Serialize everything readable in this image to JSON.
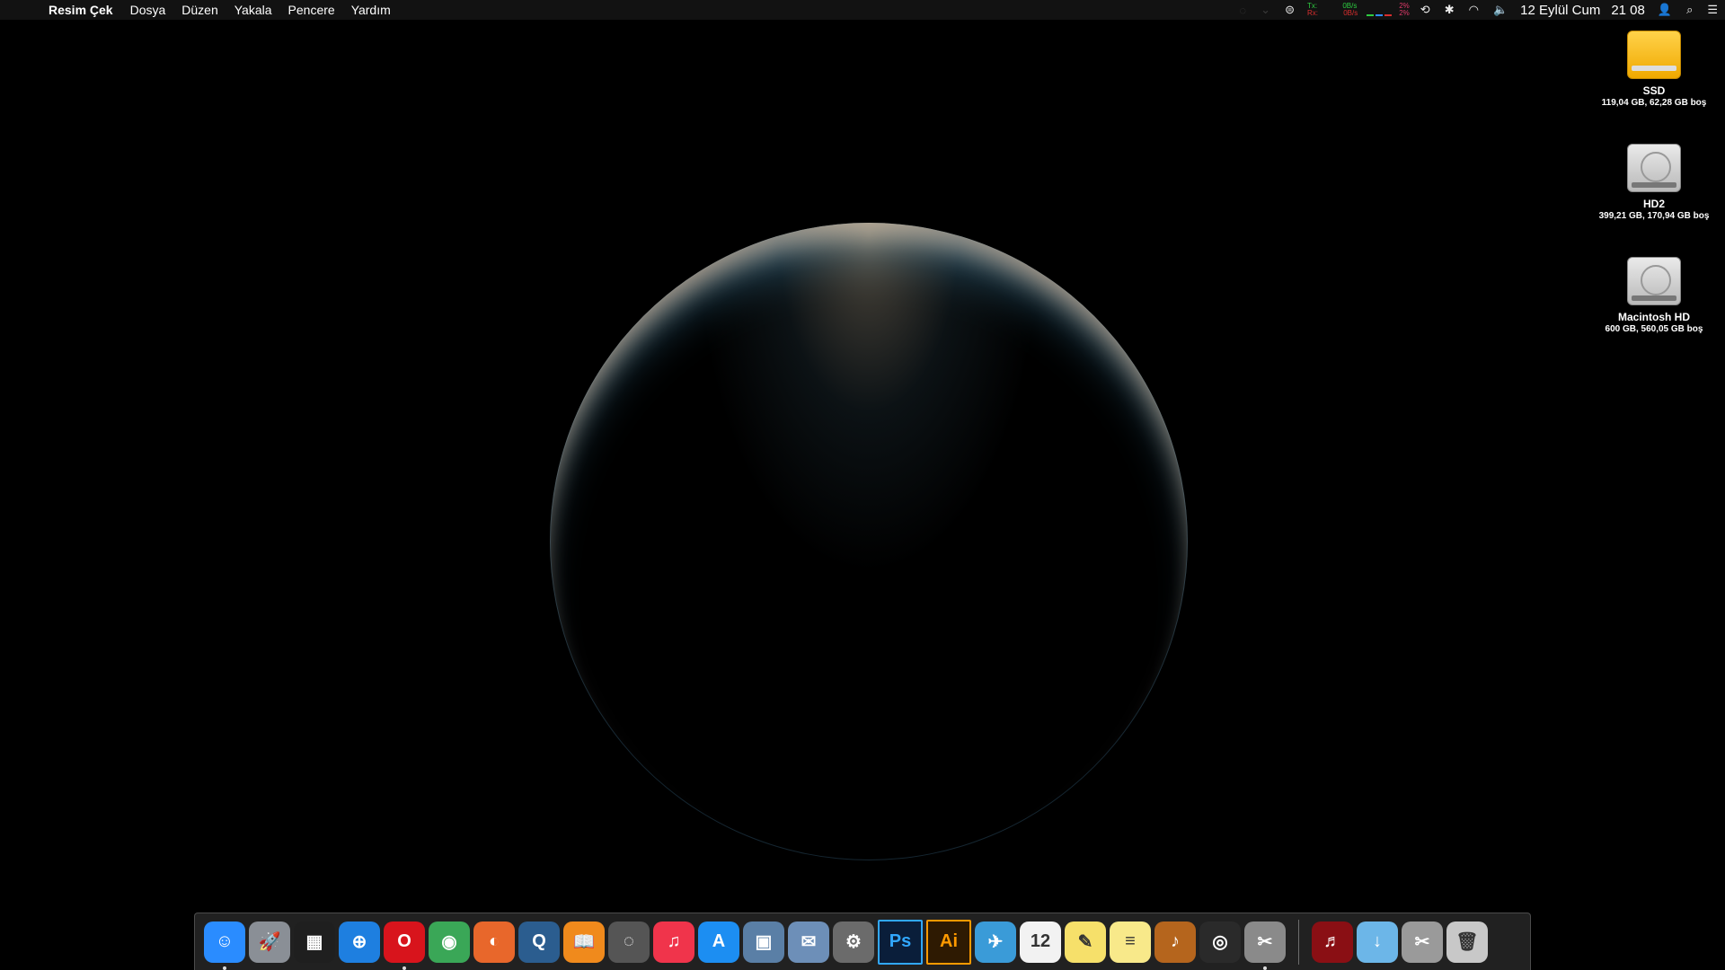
{
  "menubar": {
    "apple_glyph": "",
    "app_name": "Resim Çek",
    "menus": [
      "Dosya",
      "Düzen",
      "Yakala",
      "Pencere",
      "Yardım"
    ],
    "net_tx_label": "Tx:",
    "net_rx_label": "Rx:",
    "net_tx_value": "0B/s",
    "net_rx_value": "0B/s",
    "cpu_top": "2%",
    "cpu_bottom": "2%",
    "date": "12 Eylül Cum",
    "time": "21 08"
  },
  "drives": [
    {
      "name": "SSD",
      "info": "119,04 GB, 62,28 GB boş",
      "icon": "ssd-drive-icon"
    },
    {
      "name": "HD2",
      "info": "399,21 GB, 170,94 GB boş",
      "icon": "hard-drive-icon"
    },
    {
      "name": "Macintosh HD",
      "info": "600 GB, 560,05 GB boş",
      "icon": "hard-drive-icon"
    }
  ],
  "dock": {
    "apps": [
      {
        "icon": "finder-icon",
        "glyph": "☺",
        "color": "#2a8cff",
        "running": true
      },
      {
        "icon": "launchpad-icon",
        "glyph": "🚀",
        "color": "#8a8f96",
        "running": false
      },
      {
        "icon": "mission-control-icon",
        "glyph": "▦",
        "color": "#1f1f1f",
        "running": false
      },
      {
        "icon": "safari-icon",
        "glyph": "⊕",
        "color": "#1e7fe0",
        "running": false
      },
      {
        "icon": "opera-icon",
        "glyph": "O",
        "color": "#d8141c",
        "running": true
      },
      {
        "icon": "chrome-icon",
        "glyph": "◉",
        "color": "#3aa757",
        "running": false
      },
      {
        "icon": "firefox-icon",
        "glyph": "◐",
        "color": "#e8672b",
        "running": false
      },
      {
        "icon": "quicktime-icon",
        "glyph": "Q",
        "color": "#2b5d8f",
        "running": false
      },
      {
        "icon": "ibooks-icon",
        "glyph": "📖",
        "color": "#f08a1c",
        "running": false
      },
      {
        "icon": "ical-sync-icon",
        "glyph": "◌",
        "color": "#555555",
        "running": false
      },
      {
        "icon": "itunes-icon",
        "glyph": "♫",
        "color": "#f0344b",
        "running": false
      },
      {
        "icon": "app-store-icon",
        "glyph": "A",
        "color": "#1c8ef2",
        "running": false
      },
      {
        "icon": "iphoto-icon",
        "glyph": "▣",
        "color": "#5a7fa6",
        "running": false
      },
      {
        "icon": "mail-icon",
        "glyph": "✉",
        "color": "#6d8fb8",
        "running": false
      },
      {
        "icon": "system-preferences-icon",
        "glyph": "⚙",
        "color": "#6b6b6b",
        "running": false
      },
      {
        "icon": "photoshop-icon",
        "glyph": "Ps",
        "color": "#0a1e3a",
        "running": false
      },
      {
        "icon": "illustrator-icon",
        "glyph": "Ai",
        "color": "#2e1a02",
        "running": false
      },
      {
        "icon": "twitter-icon",
        "glyph": "✈",
        "color": "#3a9bd8",
        "running": false
      },
      {
        "icon": "calendar-icon",
        "glyph": "12",
        "color": "#f2f2f2",
        "running": false
      },
      {
        "icon": "stickies-icon",
        "glyph": "✎",
        "color": "#f6e06a",
        "running": false
      },
      {
        "icon": "notes-icon",
        "glyph": "≡",
        "color": "#f8e98a",
        "running": false
      },
      {
        "icon": "garageband-icon",
        "glyph": "♪",
        "color": "#b5651d",
        "running": false
      },
      {
        "icon": "visibility-icon",
        "glyph": "◎",
        "color": "#2a2a2a",
        "running": false
      },
      {
        "icon": "screenshot-icon",
        "glyph": "✂",
        "color": "#8a8a8a",
        "running": true
      }
    ],
    "stack": [
      {
        "icon": "guitar-pro-icon",
        "glyph": "♬",
        "color": "#8a0f14"
      },
      {
        "icon": "downloads-folder-icon",
        "glyph": "↓",
        "color": "#6cb6e8"
      },
      {
        "icon": "preview-icon",
        "glyph": "✂",
        "color": "#9a9a9a"
      },
      {
        "icon": "trash-icon",
        "glyph": "🗑",
        "color": "#c8c8c8"
      }
    ]
  }
}
